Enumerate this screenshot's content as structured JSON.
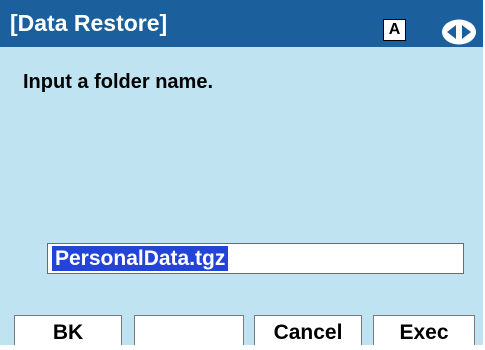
{
  "title_bar": {
    "title": "[Data Restore]",
    "mode_indicator": "A",
    "nav_icon": "left-right-arrows-icon"
  },
  "prompt": "Input a folder name.",
  "input": {
    "value": "PersonalData.tgz"
  },
  "softkeys": [
    "BK",
    "",
    "Cancel",
    "Exec"
  ],
  "colors": {
    "title_bar": "#1b5f9c",
    "screen_background": "#bfe3f0",
    "selection": "#2244d8"
  }
}
